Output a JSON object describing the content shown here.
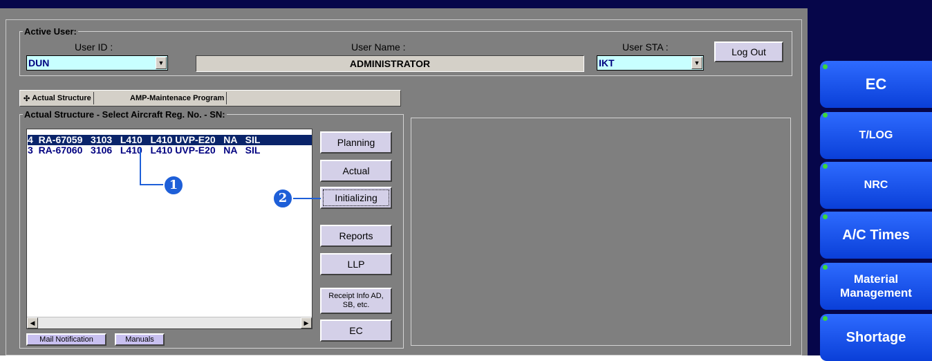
{
  "active_user": {
    "legend": "Active User:",
    "user_id_label": "User ID :",
    "user_id_value": "DUN",
    "user_name_label": "User Name :",
    "user_name_value": "ADMINISTRATOR",
    "user_sta_label": "User STA :",
    "user_sta_value": "IKT",
    "logout_label": "Log Out"
  },
  "tabs": [
    {
      "label": "Actual Structure",
      "active": true
    },
    {
      "label": "AMP-Maintenace Program",
      "active": false
    }
  ],
  "structure": {
    "legend": "Actual Structure - Select Aircraft Reg. No. - SN:",
    "rows": [
      {
        "text": "4  RA-67059   3103   L410   L410 UVP-E20   NA   SIL",
        "selected": true
      },
      {
        "text": "3  RA-67060   3106   L410   L410 UVP-E20   NA   SIL",
        "selected": false
      }
    ]
  },
  "actions": {
    "planning": "Planning",
    "actual": "Actual",
    "initializing": "Initializing",
    "reports": "Reports",
    "llp": "LLP",
    "receipt_line1": "Receipt Info AD,",
    "receipt_line2": "SB, etc.",
    "ec": "EC"
  },
  "bottom_buttons": {
    "mail": "Mail Notification",
    "manuals": "Manuals"
  },
  "markers": [
    "1",
    "2"
  ],
  "side_nav": [
    {
      "label": "EC"
    },
    {
      "label": "T/LOG"
    },
    {
      "label": "NRC"
    },
    {
      "label": "A/C Times"
    },
    {
      "label_line1": "Material",
      "label_line2": "Management"
    },
    {
      "label": "Shortage"
    }
  ],
  "colors": {
    "accent_blue": "#1e5fd8",
    "panel_gray": "#7f7f7f",
    "combo_cyan": "#c8ffff",
    "selection_navy": "#0a246a"
  }
}
